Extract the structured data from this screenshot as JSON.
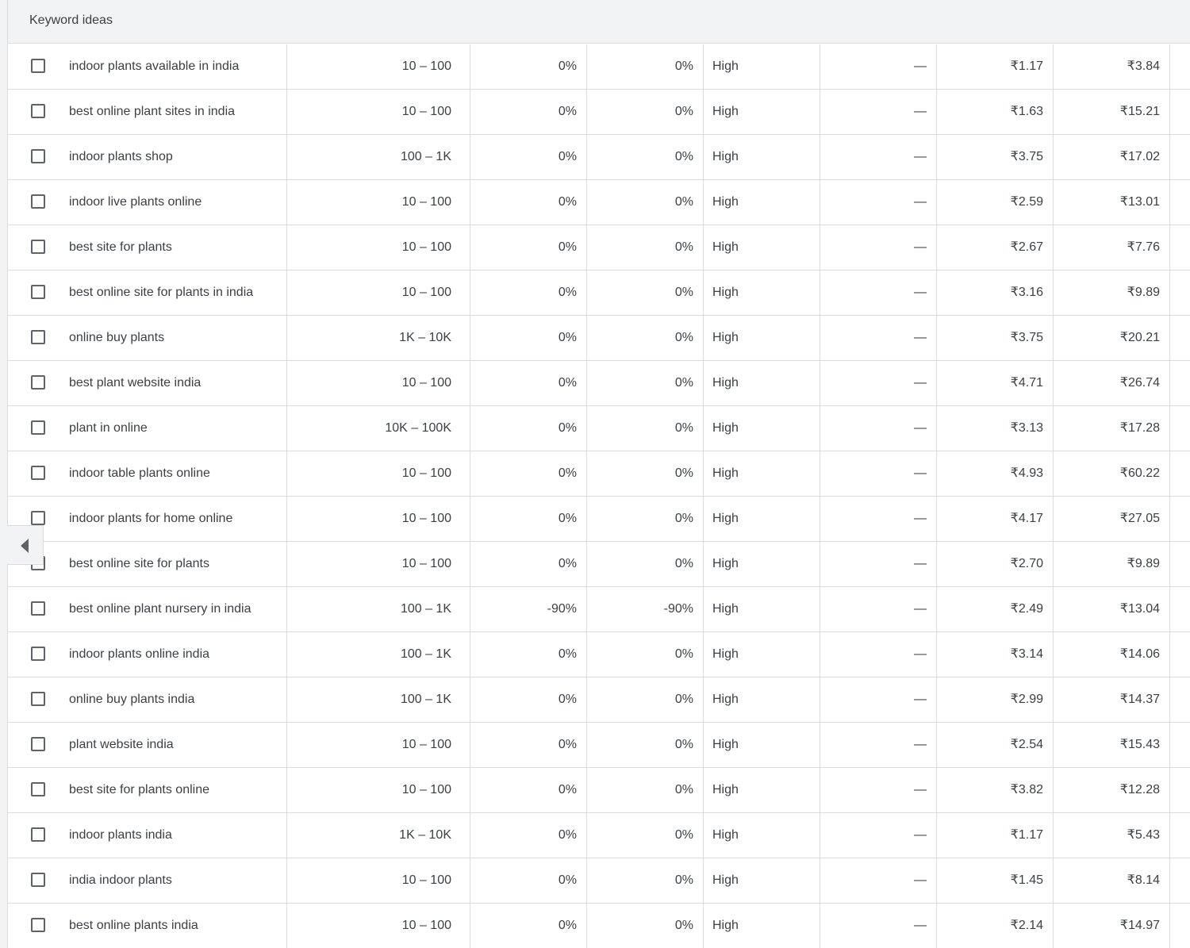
{
  "section": {
    "title": "Keyword ideas"
  },
  "collapse_icon": "chevron-left-icon",
  "rows": [
    {
      "keyword": "indoor plants available in india",
      "volume": "10 – 100",
      "three_month": "0%",
      "yoy": "0%",
      "competition": "High",
      "ad_impr": "—",
      "bid_low": "₹1.17",
      "bid_high": "₹3.84"
    },
    {
      "keyword": "best online plant sites in india",
      "volume": "10 – 100",
      "three_month": "0%",
      "yoy": "0%",
      "competition": "High",
      "ad_impr": "—",
      "bid_low": "₹1.63",
      "bid_high": "₹15.21"
    },
    {
      "keyword": "indoor plants shop",
      "volume": "100 – 1K",
      "three_month": "0%",
      "yoy": "0%",
      "competition": "High",
      "ad_impr": "—",
      "bid_low": "₹3.75",
      "bid_high": "₹17.02"
    },
    {
      "keyword": "indoor live plants online",
      "volume": "10 – 100",
      "three_month": "0%",
      "yoy": "0%",
      "competition": "High",
      "ad_impr": "—",
      "bid_low": "₹2.59",
      "bid_high": "₹13.01"
    },
    {
      "keyword": "best site for plants",
      "volume": "10 – 100",
      "three_month": "0%",
      "yoy": "0%",
      "competition": "High",
      "ad_impr": "—",
      "bid_low": "₹2.67",
      "bid_high": "₹7.76"
    },
    {
      "keyword": "best online site for plants in india",
      "volume": "10 – 100",
      "three_month": "0%",
      "yoy": "0%",
      "competition": "High",
      "ad_impr": "—",
      "bid_low": "₹3.16",
      "bid_high": "₹9.89"
    },
    {
      "keyword": "online buy plants",
      "volume": "1K – 10K",
      "three_month": "0%",
      "yoy": "0%",
      "competition": "High",
      "ad_impr": "—",
      "bid_low": "₹3.75",
      "bid_high": "₹20.21"
    },
    {
      "keyword": "best plant website india",
      "volume": "10 – 100",
      "three_month": "0%",
      "yoy": "0%",
      "competition": "High",
      "ad_impr": "—",
      "bid_low": "₹4.71",
      "bid_high": "₹26.74"
    },
    {
      "keyword": "plant in online",
      "volume": "10K – 100K",
      "three_month": "0%",
      "yoy": "0%",
      "competition": "High",
      "ad_impr": "—",
      "bid_low": "₹3.13",
      "bid_high": "₹17.28"
    },
    {
      "keyword": "indoor table plants online",
      "volume": "10 – 100",
      "three_month": "0%",
      "yoy": "0%",
      "competition": "High",
      "ad_impr": "—",
      "bid_low": "₹4.93",
      "bid_high": "₹60.22"
    },
    {
      "keyword": "indoor plants for home online",
      "volume": "10 – 100",
      "three_month": "0%",
      "yoy": "0%",
      "competition": "High",
      "ad_impr": "—",
      "bid_low": "₹4.17",
      "bid_high": "₹27.05"
    },
    {
      "keyword": "best online site for plants",
      "volume": "10 – 100",
      "three_month": "0%",
      "yoy": "0%",
      "competition": "High",
      "ad_impr": "—",
      "bid_low": "₹2.70",
      "bid_high": "₹9.89"
    },
    {
      "keyword": "best online plant nursery in india",
      "volume": "100 – 1K",
      "three_month": "-90%",
      "yoy": "-90%",
      "competition": "High",
      "ad_impr": "—",
      "bid_low": "₹2.49",
      "bid_high": "₹13.04"
    },
    {
      "keyword": "indoor plants online india",
      "volume": "100 – 1K",
      "three_month": "0%",
      "yoy": "0%",
      "competition": "High",
      "ad_impr": "—",
      "bid_low": "₹3.14",
      "bid_high": "₹14.06"
    },
    {
      "keyword": "online buy plants india",
      "volume": "100 – 1K",
      "three_month": "0%",
      "yoy": "0%",
      "competition": "High",
      "ad_impr": "—",
      "bid_low": "₹2.99",
      "bid_high": "₹14.37"
    },
    {
      "keyword": "plant website india",
      "volume": "10 – 100",
      "three_month": "0%",
      "yoy": "0%",
      "competition": "High",
      "ad_impr": "—",
      "bid_low": "₹2.54",
      "bid_high": "₹15.43"
    },
    {
      "keyword": "best site for plants online",
      "volume": "10 – 100",
      "three_month": "0%",
      "yoy": "0%",
      "competition": "High",
      "ad_impr": "—",
      "bid_low": "₹3.82",
      "bid_high": "₹12.28"
    },
    {
      "keyword": "indoor plants india",
      "volume": "1K – 10K",
      "three_month": "0%",
      "yoy": "0%",
      "competition": "High",
      "ad_impr": "—",
      "bid_low": "₹1.17",
      "bid_high": "₹5.43"
    },
    {
      "keyword": "india indoor plants",
      "volume": "10 – 100",
      "three_month": "0%",
      "yoy": "0%",
      "competition": "High",
      "ad_impr": "—",
      "bid_low": "₹1.45",
      "bid_high": "₹8.14"
    },
    {
      "keyword": "best online plants india",
      "volume": "10 – 100",
      "three_month": "0%",
      "yoy": "0%",
      "competition": "High",
      "ad_impr": "—",
      "bid_low": "₹2.14",
      "bid_high": "₹14.97"
    }
  ]
}
